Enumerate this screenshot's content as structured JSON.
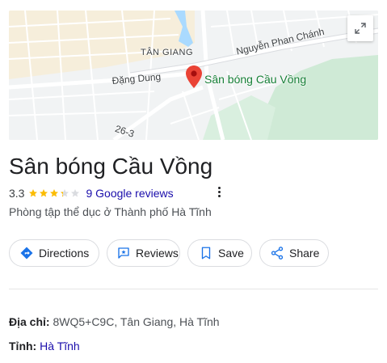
{
  "map": {
    "labels": {
      "tan_giang": "TÂN GIANG",
      "nguyen_phan_chanh": "Nguyễn Phan Chánh",
      "dang_dung": "Đặng Dung",
      "road_26_3": "26-3"
    },
    "place_label": "Sân bóng Cầu Vồng",
    "expand_icon": "expand-diagonal-icon"
  },
  "place": {
    "title": "Sân bóng Cầu Vồng",
    "rating": "3.3",
    "stars_value": 3.3,
    "reviews_link": "9 Google reviews",
    "category": "Phòng tập thể dục ở Thành phố Hà Tĩnh"
  },
  "actions": {
    "directions": "Directions",
    "reviews": "Reviews",
    "save": "Save",
    "share": "Share"
  },
  "info": {
    "address_label": "Địa chỉ:",
    "address_value": "8WQ5+C9C, Tân Giang, Hà Tĩnh",
    "province_label": "Tỉnh:",
    "province_value": "Hà Tĩnh"
  },
  "colors": {
    "link": "#1a0dab",
    "star": "#fbbc04",
    "star_empty": "#dadce0",
    "pin": "#ea4335",
    "place_label": "#188038",
    "directions_icon": "#1a73e8"
  }
}
